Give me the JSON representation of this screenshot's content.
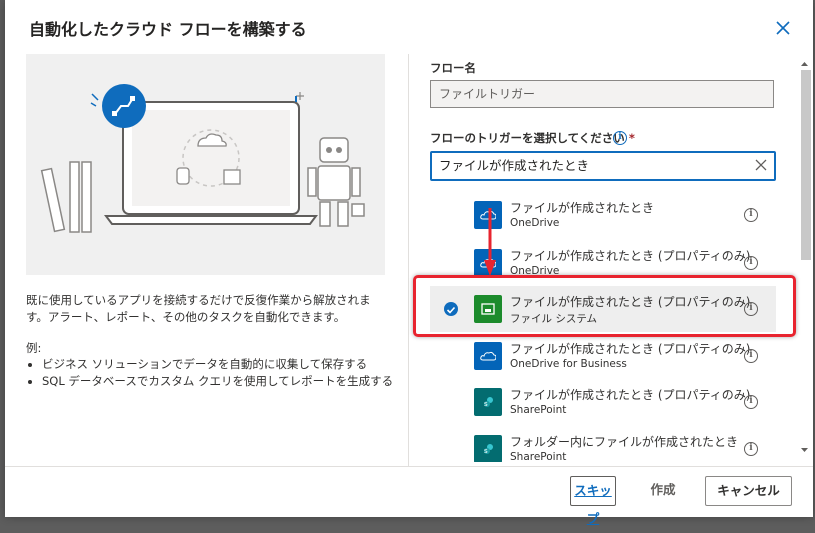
{
  "dialog": {
    "title": "自動化したクラウド フローを構築する",
    "description": "既に使用しているアプリを接続するだけで反復作業から解放されます。アラート、レポート、その他のタスクを自動化できます。",
    "examples_title": "例:",
    "examples": [
      "ビジネス ソリューションでデータを自動的に収集して保存する",
      "SQL データベースでカスタム クエリを使用してレポートを生成する"
    ]
  },
  "form": {
    "flow_name_label": "フロー名",
    "flow_name_value": "ファイルトリガー",
    "trigger_label": "フローのトリガーを選択してください",
    "required_mark": "*",
    "search_value": "ファイルが作成されたとき"
  },
  "triggers": [
    {
      "name": "ファイルが作成されたとき",
      "connector": "OneDrive",
      "icon": "onedrive-icon",
      "color": "#0364b8",
      "selected": false
    },
    {
      "name": "ファイルが作成されたとき (プロパティのみ)",
      "connector": "OneDrive",
      "icon": "onedrive-icon",
      "color": "#0364b8",
      "selected": false
    },
    {
      "name": "ファイルが作成されたとき (プロパティのみ)",
      "connector": "ファイル システム",
      "icon": "file-system-icon",
      "color": "#1c8b2c",
      "selected": true
    },
    {
      "name": "ファイルが作成されたとき (プロパティのみ)",
      "connector": "OneDrive for Business",
      "icon": "onedrive-business-icon",
      "color": "#0364b8",
      "selected": false
    },
    {
      "name": "ファイルが作成されたとき (プロパティのみ)",
      "connector": "SharePoint",
      "icon": "sharepoint-icon",
      "color": "#036c70",
      "selected": false
    },
    {
      "name": "フォルダー内にファイルが作成されたとき",
      "connector": "SharePoint",
      "icon": "sharepoint-icon",
      "color": "#036c70",
      "selected": false
    }
  ],
  "footer": {
    "skip_label": "スキップ",
    "create_label": "作成",
    "cancel_label": "キャンセル"
  },
  "colors": {
    "accent": "#0f6cbd",
    "highlight": "#e8242f"
  }
}
